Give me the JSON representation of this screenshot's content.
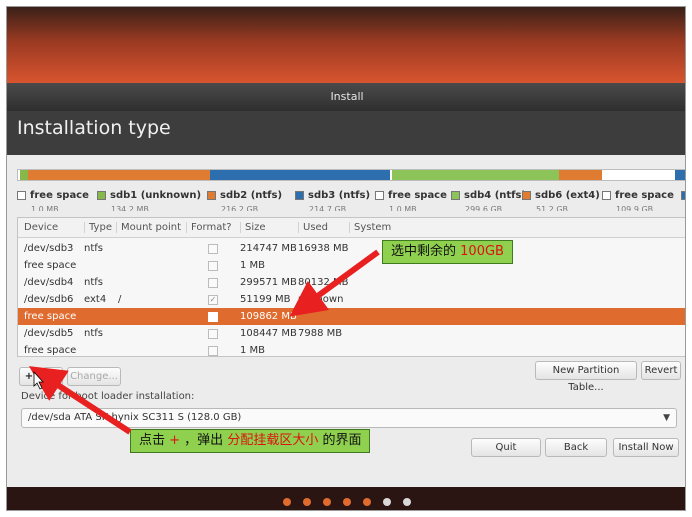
{
  "window": {
    "title": "Install"
  },
  "page": {
    "title": "Installation type"
  },
  "partition_bar": [
    {
      "label": "free space",
      "size": "1.0 MB",
      "color": "#ffffff",
      "fraction": 0.003
    },
    {
      "label": "sdb1 (unknown)",
      "size": "134.2 MB",
      "color": "#86b84a",
      "fraction": 0.012
    },
    {
      "label": "sdb2 (ntfs)",
      "size": "216.2 GB",
      "color": "#e07b32",
      "fraction": 0.272
    },
    {
      "label": "sdb3 (ntfs)",
      "size": "214.7 GB",
      "color": "#2d6eae",
      "fraction": 0.268
    },
    {
      "label": "free space",
      "size": "1.0 MB",
      "color": "#ffffff",
      "fraction": 0.003
    },
    {
      "label": "sdb4 (ntfs)",
      "size": "299.6 GB",
      "color": "#8dc45a",
      "fraction": 0.25
    },
    {
      "label": "sdb6 (ext4)",
      "size": "51.2 GB",
      "color": "#e07b32",
      "fraction": 0.064
    },
    {
      "label": "free space",
      "size": "109.9 GB",
      "color": "#ffffff",
      "fraction": 0.108
    },
    {
      "label": "",
      "size": "",
      "color": "#2d6eae",
      "fraction": 0.02
    }
  ],
  "table": {
    "headers": {
      "device": "Device",
      "type": "Type",
      "mount": "Mount point",
      "format": "Format?",
      "size": "Size",
      "used": "Used",
      "system": "System"
    },
    "rows": [
      {
        "device": "/dev/sdb3",
        "type": "ntfs",
        "mount": "",
        "format": "",
        "size": "214747 MB",
        "used": "16938 MB",
        "selected": false
      },
      {
        "device": "free space",
        "type": "",
        "mount": "",
        "format": "",
        "size": "1 MB",
        "used": "",
        "selected": false
      },
      {
        "device": "/dev/sdb4",
        "type": "ntfs",
        "mount": "",
        "format": "",
        "size": "299571 MB",
        "used": "80132 MB",
        "selected": false
      },
      {
        "device": "/dev/sdb6",
        "type": "ext4",
        "mount": "/",
        "format": "✓",
        "size": "51199 MB",
        "used": "unknown",
        "selected": false
      },
      {
        "device": "free space",
        "type": "",
        "mount": "",
        "format": "",
        "size": "109862 MB",
        "used": "",
        "selected": true
      },
      {
        "device": "/dev/sdb5",
        "type": "ntfs",
        "mount": "",
        "format": "",
        "size": "108447 MB",
        "used": "7988 MB",
        "selected": false
      },
      {
        "device": "free space",
        "type": "",
        "mount": "",
        "format": "",
        "size": "1 MB",
        "used": "",
        "selected": false
      }
    ]
  },
  "toolbar": {
    "add": "+",
    "remove": "-",
    "change": "Change...",
    "new_table": "New Partition Table...",
    "revert": "Revert"
  },
  "bootloader": {
    "label": "Device for boot loader installation:",
    "value": "/dev/sda   ATA SK hynix SC311 S (128.0 GB)"
  },
  "actions": {
    "quit": "Quit",
    "back": "Back",
    "install": "Install Now"
  },
  "progress_dots": {
    "total": 7,
    "active": 5
  },
  "annotations": {
    "select": {
      "text": "选中剩余的",
      "value": "100GB"
    },
    "click": {
      "prefix": "点击 ",
      "plus": "+",
      "middle": " ，弹出 ",
      "highlight": "分配挂载区大小",
      "suffix": " 的界面"
    }
  },
  "colors": {
    "accent": "#e06b2e",
    "annotation_bg": "#8fd14f",
    "arrow": "#e82020"
  }
}
